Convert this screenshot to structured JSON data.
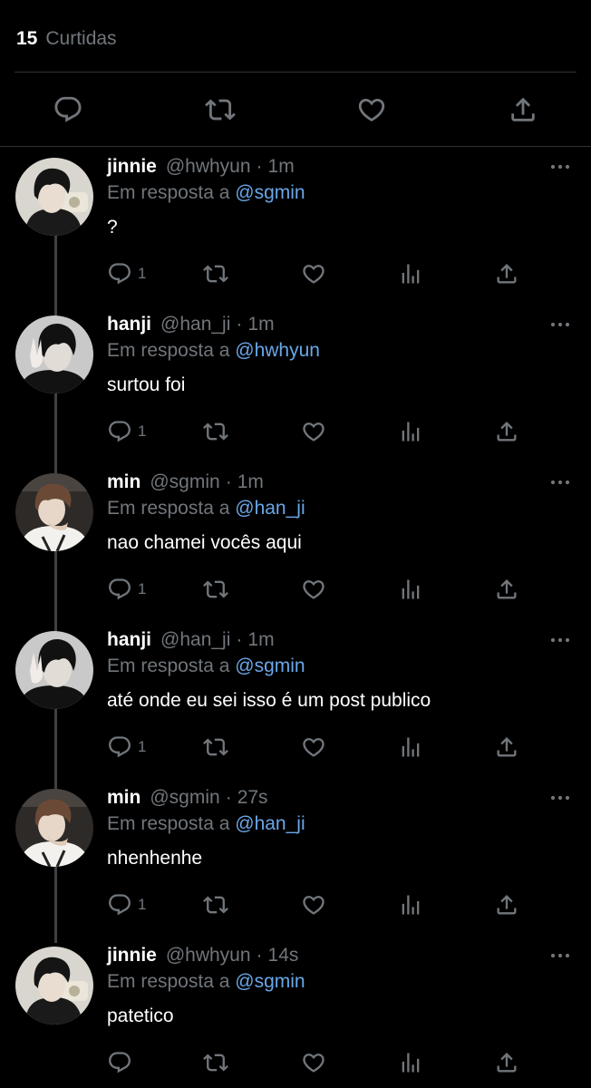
{
  "stats": {
    "likes_count": "15",
    "likes_label": "Curtidas"
  },
  "main_actions": [
    "reply-icon",
    "retweet-icon",
    "like-icon",
    "share-icon"
  ],
  "colors": {
    "background": "#000000",
    "muted": "#71767b",
    "mention": "#6aa7e8",
    "divider": "#2f3336"
  },
  "replies": [
    {
      "name": "jinnie",
      "handle": "@hwhyun",
      "sep": "·",
      "time": "1m",
      "reply_prefix": "Em resposta a",
      "reply_to": "@sgmin",
      "text": "?",
      "reply_count": "1"
    },
    {
      "name": "hanji",
      "handle": "@han_ji",
      "sep": "·",
      "time": "1m",
      "reply_prefix": "Em resposta a",
      "reply_to": "@hwhyun",
      "text": "surtou foi",
      "reply_count": "1"
    },
    {
      "name": "min",
      "handle": "@sgmin",
      "sep": "·",
      "time": "1m",
      "reply_prefix": "Em resposta a",
      "reply_to": "@han_ji",
      "text": "nao chamei vocês aqui",
      "reply_count": "1"
    },
    {
      "name": "hanji",
      "handle": "@han_ji",
      "sep": "·",
      "time": "1m",
      "reply_prefix": "Em resposta a",
      "reply_to": "@sgmin",
      "text": "até onde eu sei isso é um post publico",
      "reply_count": "1"
    },
    {
      "name": "min",
      "handle": "@sgmin",
      "sep": "·",
      "time": "27s",
      "reply_prefix": "Em resposta a",
      "reply_to": "@han_ji",
      "text": "nhenhenhe",
      "reply_count": "1"
    },
    {
      "name": "jinnie",
      "handle": "@hwhyun",
      "sep": "·",
      "time": "14s",
      "reply_prefix": "Em resposta a",
      "reply_to": "@sgmin",
      "text": "patetico",
      "reply_count": ""
    }
  ]
}
